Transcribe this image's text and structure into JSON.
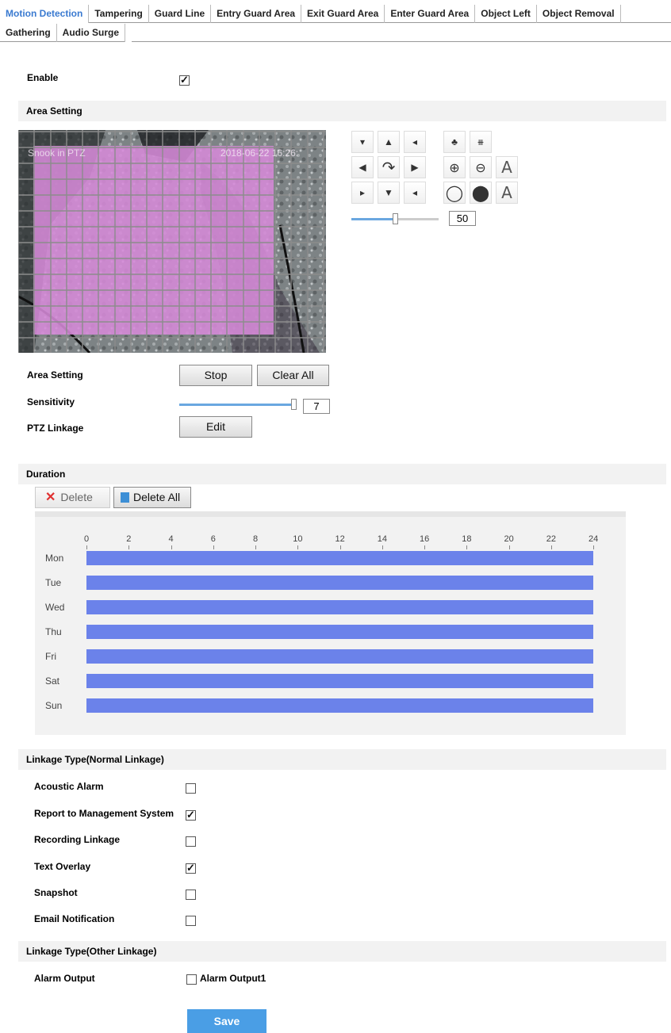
{
  "tabs_row1": [
    "Motion Detection",
    "Tampering",
    "Guard Line",
    "Entry Guard Area",
    "Exit Guard Area",
    "Enter Guard Area",
    "Object Left",
    "Object Removal"
  ],
  "tabs_row2": [
    "Gathering",
    "Audio Surge"
  ],
  "active_tab": "Motion Detection",
  "enable": {
    "label": "Enable",
    "checked": true
  },
  "area_section": {
    "title": "Area Setting"
  },
  "video": {
    "overlay_left": "Snook in PTZ",
    "overlay_right": "2018-06-22 16:26:"
  },
  "ptz": {
    "zoom_value": "50"
  },
  "area_setting": {
    "label": "Area Setting",
    "stop": "Stop",
    "clear_all": "Clear All"
  },
  "sensitivity": {
    "label": "Sensitivity",
    "value": "7",
    "level_fraction": 0.99
  },
  "ptz_linkage": {
    "label": "PTZ Linkage",
    "edit": "Edit"
  },
  "duration": {
    "title": "Duration",
    "delete": "Delete",
    "delete_all": "Delete All"
  },
  "schedule": {
    "hours": [
      "0",
      "2",
      "4",
      "6",
      "8",
      "10",
      "12",
      "14",
      "16",
      "18",
      "20",
      "22",
      "24"
    ],
    "days": [
      "Mon",
      "Tue",
      "Wed",
      "Thu",
      "Fri",
      "Sat",
      "Sun"
    ],
    "bar_color": "#6b82ea",
    "range": [
      0,
      24
    ]
  },
  "linkage_normal": {
    "title": "Linkage Type(Normal Linkage)",
    "items": [
      {
        "label": "Acoustic Alarm",
        "checked": false
      },
      {
        "label": "Report to Management System",
        "checked": true
      },
      {
        "label": "Recording Linkage",
        "checked": false
      },
      {
        "label": "Text Overlay",
        "checked": true
      },
      {
        "label": "Snapshot",
        "checked": false
      },
      {
        "label": "Email Notification",
        "checked": false
      }
    ]
  },
  "linkage_other": {
    "title": "Linkage Type(Other Linkage)",
    "alarm_output_label": "Alarm Output",
    "alarm_output_option": "Alarm Output1",
    "alarm_output_checked": false
  },
  "save": "Save",
  "colors": {
    "accent": "#3a7ad0",
    "save_button": "#4a9ee5",
    "motion_mask": "#d68ad8"
  }
}
